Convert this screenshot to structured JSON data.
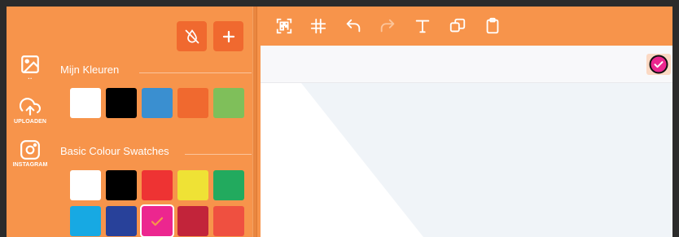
{
  "rail": {
    "items": [
      {
        "icon": "image-icon",
        "label": ""
      },
      {
        "icon": "upload-cloud-icon",
        "label": "UPLOADEN"
      },
      {
        "icon": "instagram-icon",
        "label": "INSTAGRAM"
      }
    ]
  },
  "panel": {
    "no_color_icon": "no-color-icon",
    "add_icon": "plus-icon",
    "my_colors_title": "Mijn Kleuren",
    "basic_swatches_title": "Basic Colour Swatches",
    "my_colors": [
      "#ffffff",
      "#000000",
      "#3a8fd0",
      "#f0692f",
      "#7fbf5a"
    ],
    "basic_swatches": [
      "#ffffff",
      "#000000",
      "#ee3333",
      "#efe235",
      "#22aa5e",
      "#17a9e3",
      "#28419a",
      "#ec268f",
      "#c2243a",
      "#ef5040"
    ],
    "selected_swatch": "#ec268f"
  },
  "toolbar": {
    "tools": [
      "qr-code-icon",
      "grid-hash-icon",
      "undo-icon",
      "redo-icon",
      "text-icon",
      "shapes-icon",
      "clipboard-icon"
    ]
  },
  "colors": {
    "accent": "#f7944b",
    "accent_dark": "#f0692f",
    "selected_pink": "#ec268f",
    "canvas_shape": "#f0f4f8"
  }
}
